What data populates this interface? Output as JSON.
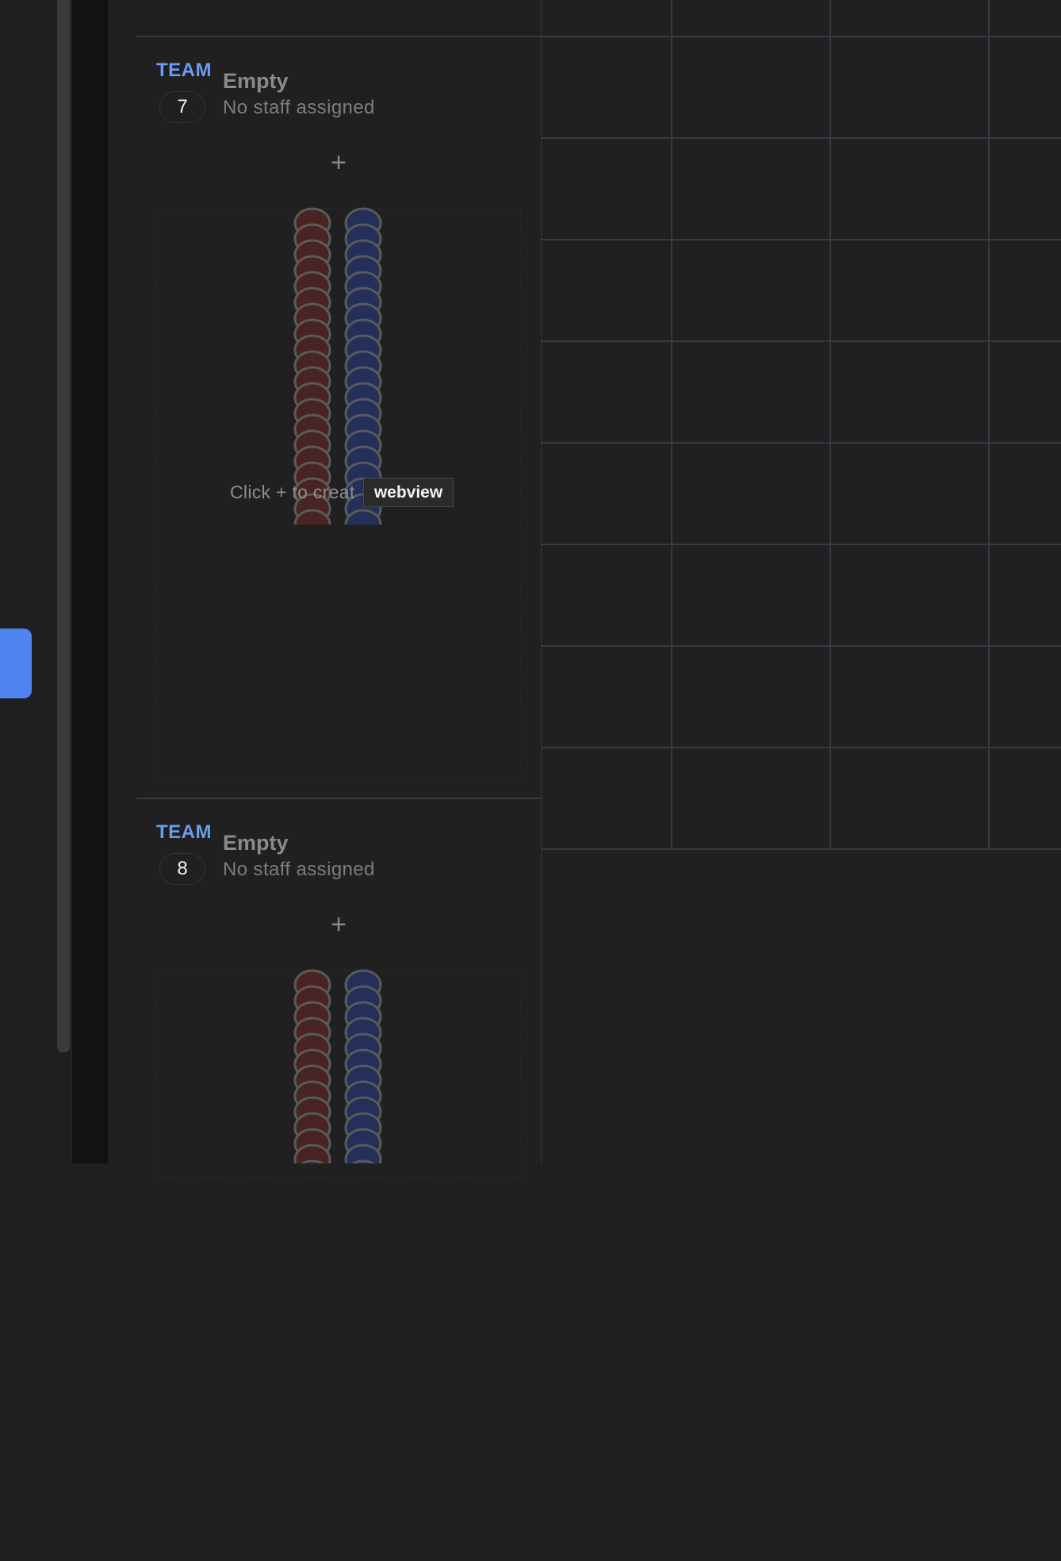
{
  "teams": [
    {
      "label": "TEAM",
      "number": "7",
      "name": "Empty",
      "subtitle": "No staff assigned",
      "add_symbol": "+",
      "hint": "Click + to creat"
    },
    {
      "label": "TEAM",
      "number": "8",
      "name": "Empty",
      "subtitle": "No staff assigned",
      "add_symbol": "+"
    }
  ],
  "tooltip": "webview",
  "colors": {
    "accent": "#4f83f0",
    "team_label": "#6a9cf2",
    "red_disc": "#4a2424",
    "blue_disc": "#25305a",
    "grid_line": "#343b45"
  }
}
